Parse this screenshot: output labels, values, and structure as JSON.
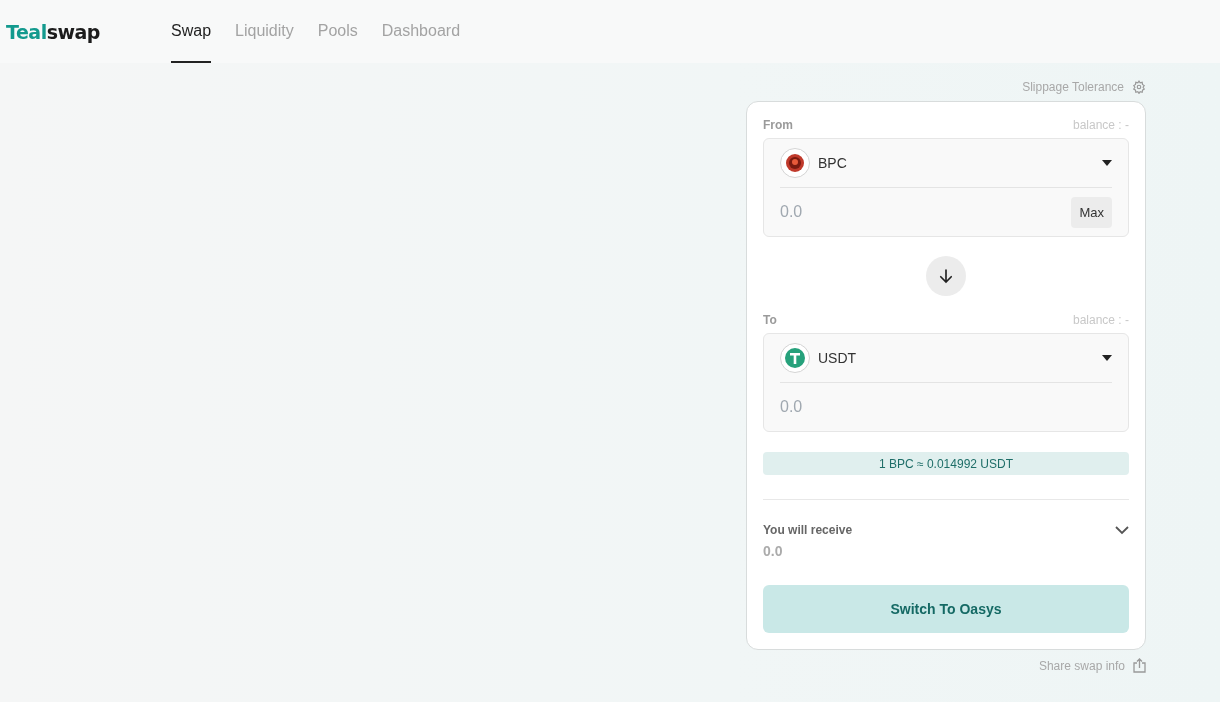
{
  "logo": {
    "accent": "Teal",
    "rest": "swap"
  },
  "nav": [
    {
      "label": "Swap",
      "selected": true
    },
    {
      "label": "Liquidity",
      "selected": false
    },
    {
      "label": "Pools",
      "selected": false
    },
    {
      "label": "Dashboard",
      "selected": false
    }
  ],
  "slippage": "Slippage Tolerance",
  "from": {
    "label": "From",
    "balance": "balance : -",
    "token": {
      "symbol": "BPC",
      "kind": "bpc"
    },
    "placeholder": "0.0",
    "max": "Max"
  },
  "to": {
    "label": "To",
    "balance": "balance : -",
    "token": {
      "symbol": "USDT",
      "kind": "usdt"
    },
    "placeholder": "0.0"
  },
  "rate": "1 BPC ≈ 0.014992 USDT",
  "receive": {
    "label": "You will receive",
    "value": "0.0",
    "expanded": false
  },
  "action": "Switch To Oasys",
  "share": "Share swap info"
}
